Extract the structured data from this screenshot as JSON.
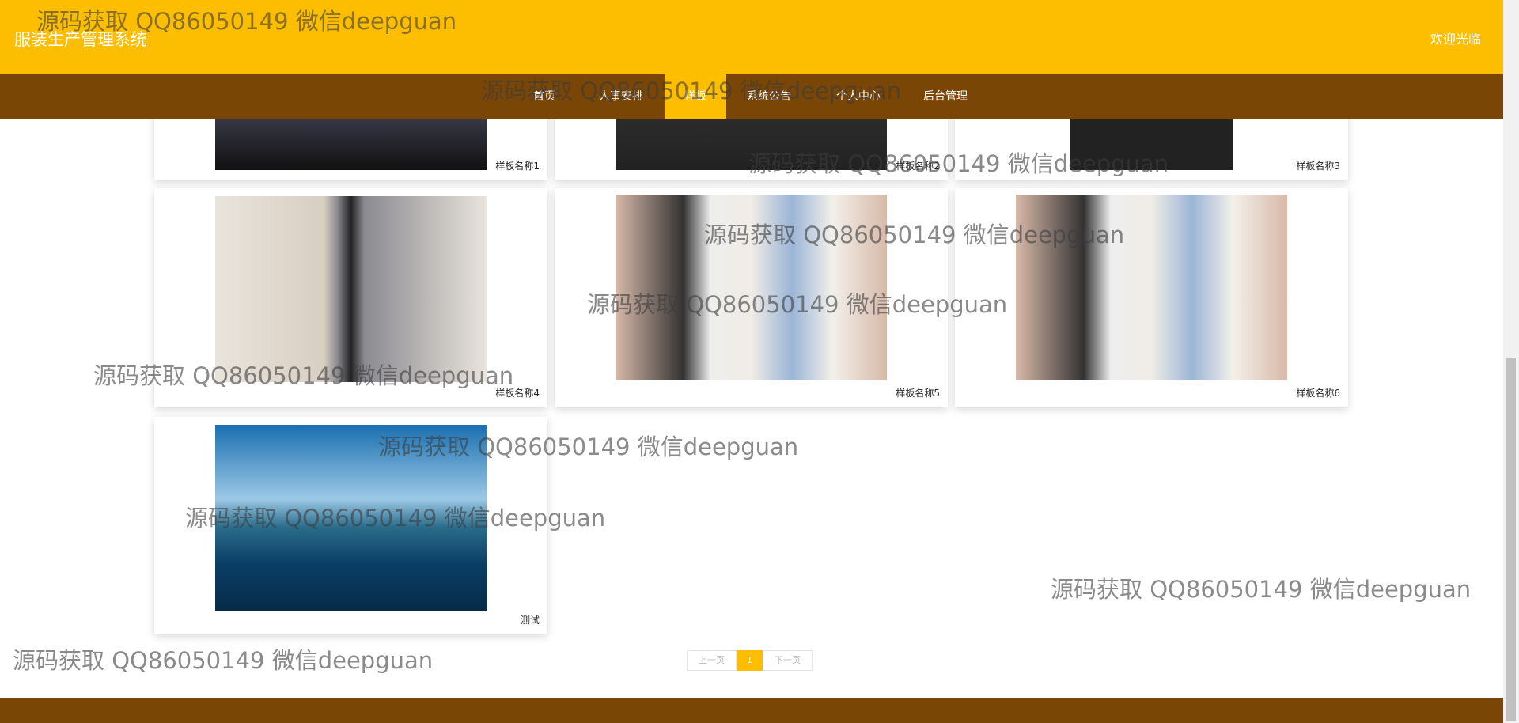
{
  "header": {
    "title": "服装生产管理系统",
    "welcome": "欢迎光临"
  },
  "nav": [
    {
      "label": "首页"
    },
    {
      "label": "人事安排"
    },
    {
      "label": "样板",
      "active": true
    },
    {
      "label": "系统公告"
    },
    {
      "label": "个人中心"
    },
    {
      "label": "后台管理"
    }
  ],
  "cards": [
    {
      "name": "样板名称1"
    },
    {
      "name": "样板名称2"
    },
    {
      "name": "样板名称3"
    },
    {
      "name": "样板名称4"
    },
    {
      "name": "样板名称5"
    },
    {
      "name": "样板名称6"
    },
    {
      "name": "测试"
    }
  ],
  "pagination": {
    "prev": "上一页",
    "current": "1",
    "next": "下一页"
  },
  "watermark": "源码获取 QQ86050149 微信deepguan",
  "colors": {
    "primary": "#fdbd01",
    "secondary": "#7a4606"
  }
}
